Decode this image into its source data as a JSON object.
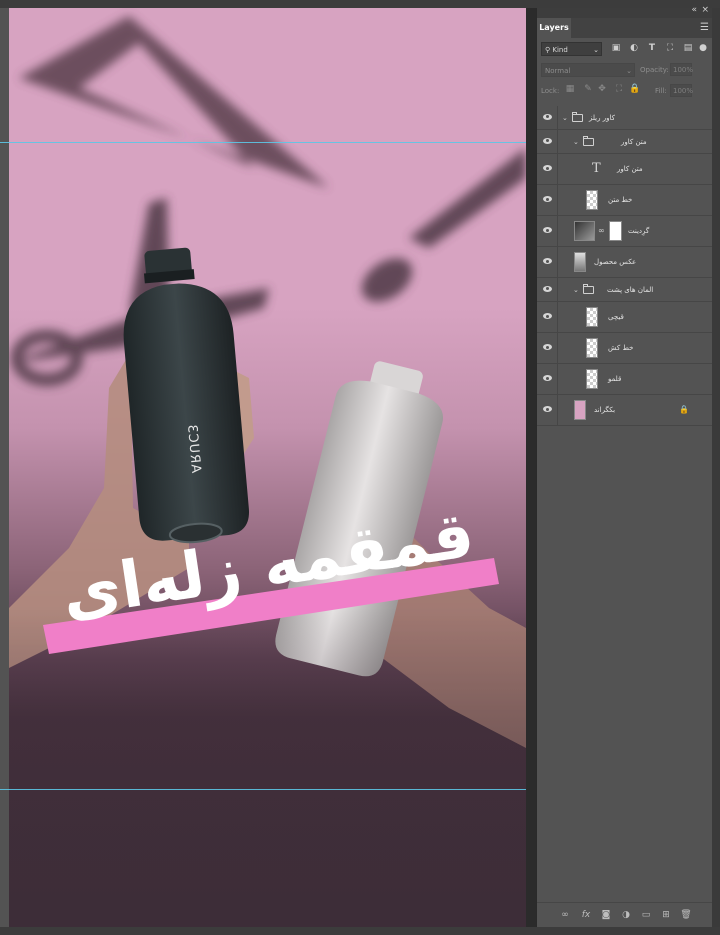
{
  "canvas": {
    "bottle_brand": "ƐƆUЯA",
    "headline": "قمقمه زله‌ای",
    "colors": {
      "background_top": "#d7a3c1",
      "background_bottom": "#3d2d38",
      "highlight_bar": "#f07fc8",
      "guide": "#5cc7e6"
    }
  },
  "panel": {
    "tab_label": "Layers",
    "filter_kind": "Kind",
    "blend_mode": "Normal",
    "opacity_label": "Opacity:",
    "opacity_value": "100%",
    "lock_label": "Lock:",
    "fill_label": "Fill:",
    "fill_value": "100%",
    "layers": [
      {
        "name": "کاور ریلز",
        "kind": "group",
        "level": 0
      },
      {
        "name": "متن کاور",
        "kind": "group",
        "level": 1
      },
      {
        "name": "متن کاور",
        "kind": "text",
        "level": 2
      },
      {
        "name": "خط متن",
        "kind": "pixel",
        "level": 2
      },
      {
        "name": "گرِدینت",
        "kind": "gradient",
        "level": 1
      },
      {
        "name": "عکس محصول",
        "kind": "photo",
        "level": 1
      },
      {
        "name": "المان های پشت",
        "kind": "group",
        "level": 1
      },
      {
        "name": "قیچی",
        "kind": "pixel",
        "level": 2
      },
      {
        "name": "خط کش",
        "kind": "pixel",
        "level": 2
      },
      {
        "name": "قلمو",
        "kind": "pixel",
        "level": 2
      },
      {
        "name": "بکگراند",
        "kind": "background",
        "level": 0
      }
    ]
  },
  "icons": [
    "eye-icon",
    "folder-icon",
    "text-layer-icon",
    "link-icon",
    "lock-icon",
    "fx-icon",
    "mask-icon",
    "adjustment-icon",
    "new-group-icon",
    "new-layer-icon",
    "trash-icon",
    "panel-menu-icon"
  ]
}
